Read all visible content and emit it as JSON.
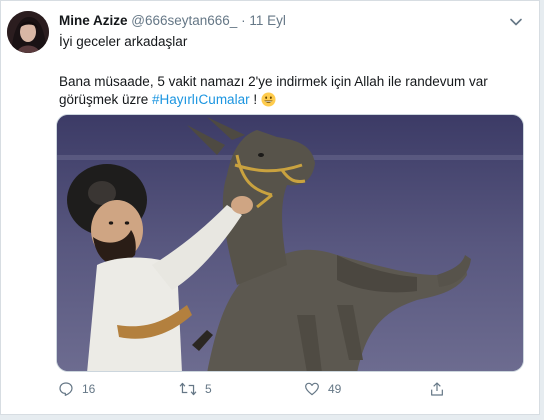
{
  "tweet": {
    "author_name": "Mine Azize",
    "handle": "@666seytan666_",
    "separator": "·",
    "date": "11 Eyl",
    "line1": "İyi geceler arkadaşlar",
    "body_text": "Bana müsaade,  5 vakit namazı 2'ye indirmek için Allah ile randevum var görüşmek üzre ",
    "hashtag": "#HayırlıCumalar",
    "after_hashtag": " !",
    "emoji_name": "grinning-face-emoji",
    "media_alt": "meme image: man in white robe grabbing a donkey's harness"
  },
  "actions": {
    "reply_count": "16",
    "retweet_count": "5",
    "like_count": "49"
  },
  "colors": {
    "accent": "#1b95e0",
    "text": "#14171a",
    "muted": "#657786",
    "background": "#e6ecf0"
  }
}
